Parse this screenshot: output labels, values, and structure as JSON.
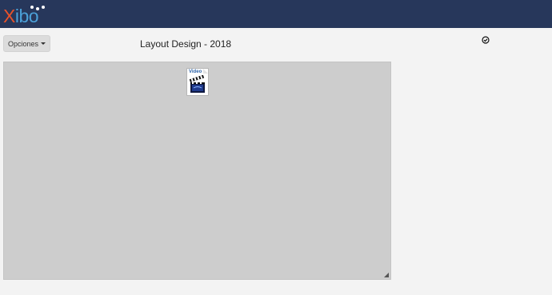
{
  "brand": {
    "logo_x": "X",
    "logo_rest": "ibo",
    "colors": {
      "navbar": "#27375b",
      "logo_x": "#e8522a",
      "logo_rest": "#4ba0d8"
    }
  },
  "toolbar": {
    "options_label": "Opciones",
    "options_icon": "caret-down-icon"
  },
  "layout": {
    "title": "Layout Design - 2018",
    "status_icon": "check-circle-icon"
  },
  "canvas": {
    "background": "#cdcdcd",
    "widgets": [
      {
        "label": "Video",
        "icon": "clapperboard-icon"
      }
    ],
    "resize_icon": "resize-handle-icon"
  }
}
